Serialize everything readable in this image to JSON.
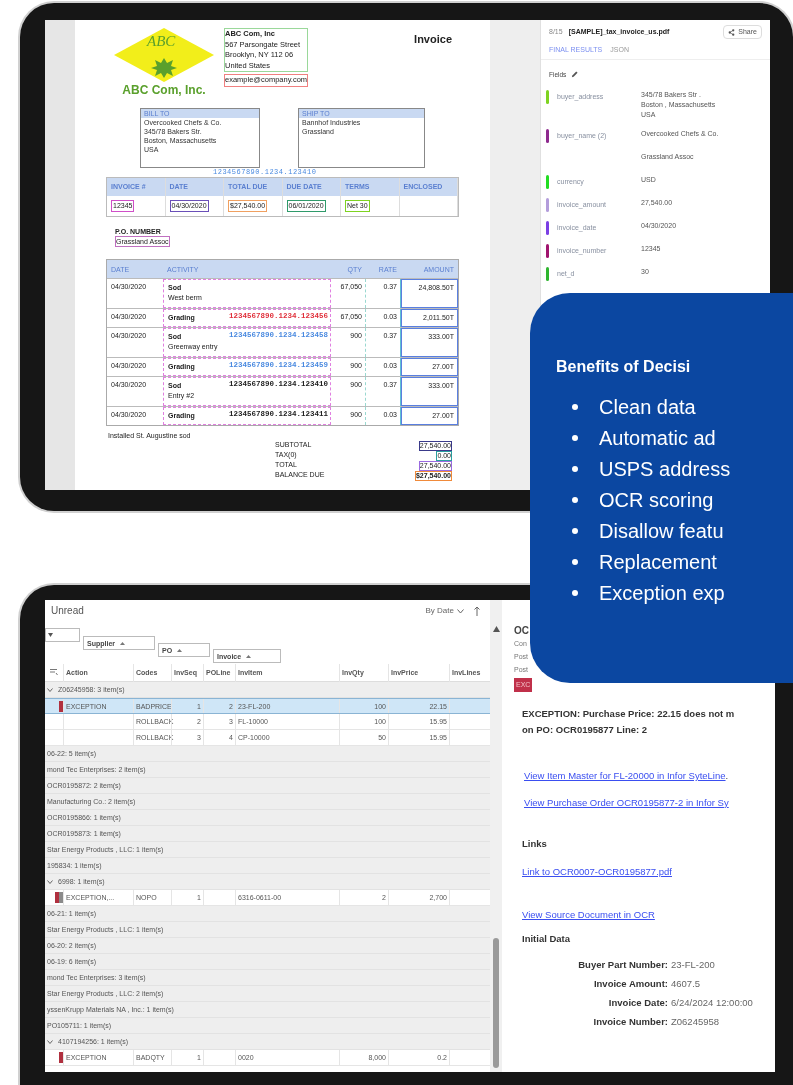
{
  "invoice_document": {
    "logo_text": "ABC",
    "company_name": "ABC Com, Inc.",
    "address": [
      "ABC Com, Inc",
      "567 Parsongate Street",
      "Brooklyn, NY 112 06",
      "United States"
    ],
    "email": "example@company.com",
    "title": "Invoice",
    "bill_to": {
      "label": "BILL TO",
      "lines": [
        "Overcooked Chefs & Co.",
        "345/78 Bakers Str.",
        "Boston, Massachusetts",
        "USA"
      ]
    },
    "ship_to": {
      "label": "SHIP TO",
      "lines": [
        "Bannhof Industries",
        "Grassland"
      ]
    },
    "reference_number": "1234567890.1234.123410",
    "summary": {
      "columns": [
        "INVOICE #",
        "DATE",
        "TOTAL DUE",
        "DUE DATE",
        "TERMS",
        "ENCLOSED"
      ],
      "values": [
        {
          "text": "12345",
          "color": "#d04fc8"
        },
        {
          "text": "04/30/2020",
          "color": "#6a4fb8"
        },
        {
          "text": "$27,540.00",
          "color": "#f0a060"
        },
        {
          "text": "06/01/2020",
          "color": "#2f9a6a"
        },
        {
          "text": "Net 30",
          "color": "#7ed321"
        }
      ]
    },
    "po_label": "P.O. NUMBER",
    "po_value": "Grassland Assoc",
    "items": {
      "columns": [
        "DATE",
        "ACTIVITY",
        "QTY",
        "RATE",
        "AMOUNT"
      ],
      "rows": [
        {
          "date": "04/30/2020",
          "activity": "Sod",
          "description": "West berm",
          "qty": "67,050",
          "rate": "0.37",
          "amount": "24,808.50T"
        },
        {
          "date": "04/30/2020",
          "activity": "Grading",
          "qty": "67,050",
          "rate": "0.03",
          "amount": "2,011.50T",
          "reference": {
            "text": "1234567890.1234.123456",
            "color": "#e0303a"
          }
        },
        {
          "date": "04/30/2020",
          "activity": "Sod",
          "description": "Greenway entry",
          "qty": "900",
          "rate": "0.37",
          "amount": "333.00T",
          "reference": {
            "text": "1234567890.1234.123458",
            "color": "#4a8ae0"
          }
        },
        {
          "date": "04/30/2020",
          "activity": "Grading",
          "qty": "900",
          "rate": "0.03",
          "amount": "27.00T",
          "reference": {
            "text": "1234567890.1234.123459",
            "color": "#4a8ae0"
          }
        },
        {
          "date": "04/30/2020",
          "activity": "Sod",
          "description": "Entry #2",
          "qty": "900",
          "rate": "0.37",
          "amount": "333.00T",
          "reference": {
            "text": "1234567890.1234.123410",
            "color": "#222222"
          }
        },
        {
          "date": "04/30/2020",
          "activity": "Grading",
          "qty": "900",
          "rate": "0.03",
          "amount": "27.00T",
          "reference": {
            "text": "1234567890.1234.123411",
            "color": "#222222"
          }
        }
      ]
    },
    "note": "Installed St. Augustine sod",
    "totals": [
      {
        "label": "SUBTOTAL",
        "value": "27,540.00",
        "color": "#3a3a8a"
      },
      {
        "label": "TAX(0)",
        "value": "0.00",
        "color": "#2aa0a0"
      },
      {
        "label": "TOTAL",
        "value": "27,540.00",
        "color": "#9a6ae0"
      },
      {
        "label": "BALANCE DUE",
        "value": "$27,540.00",
        "color": "#f08a3a"
      }
    ]
  },
  "results_panel": {
    "page": "8/15",
    "file_name": "[SAMPLE]_tax_invoice_us.pdf",
    "share_label": "Share",
    "tabs": [
      {
        "label": "FINAL RESULTS",
        "selected": true
      },
      {
        "label": "JSON",
        "selected": false
      }
    ],
    "fields_title": "Fields",
    "fields": [
      {
        "name": "buyer_address",
        "values": [
          "345/78 Bakers Str .\nBoston , Massachusetts\nUSA"
        ],
        "color": "#7ed321"
      },
      {
        "name": "buyer_name (2)",
        "values": [
          "Overcooked Chefs & Co.",
          "Grassland Assoc"
        ],
        "color": "#8e2a8e"
      },
      {
        "name": "currency",
        "values": [
          "USD"
        ],
        "color": "#22dd22"
      },
      {
        "name": "invoice_amount",
        "values": [
          "27,540.00"
        ],
        "color": "#b39ddb"
      },
      {
        "name": "invoice_date",
        "values": [
          "04/30/2020"
        ],
        "color": "#7b3fe4"
      },
      {
        "name": "invoice_number",
        "values": [
          "12345"
        ],
        "color": "#a0146e"
      },
      {
        "name": "net_d",
        "values": [
          "30"
        ],
        "color": "#2fb52f"
      }
    ]
  },
  "benefits_callout": {
    "title": "Benefits of Decisi",
    "items": [
      "Clean data",
      "Automatic ad",
      "USPS address",
      "OCR scoring",
      "Disallow featu",
      "Replacement",
      "Exception exp"
    ]
  },
  "inbox_list": {
    "title": "Unread",
    "sort_label": "By Date",
    "group_chips": [
      "Supplier",
      "PO",
      "Invoice"
    ],
    "columns": [
      "Action",
      "Codes",
      "InvSeq",
      "POLine",
      "InvItem",
      "InvQty",
      "InvPrice",
      "InvLines"
    ],
    "rows": [
      {
        "kind": "group",
        "text": "Z06245958: 3 item(s)",
        "expanded": true
      },
      {
        "kind": "item",
        "markers": [
          {
            "color": "#b0303f"
          }
        ],
        "action": "EXCEPTION",
        "code": "BADPRICE",
        "inv_seq": "1",
        "po_line": "2",
        "inv_item": "23-FL-200",
        "inv_qty": "100",
        "inv_price": "22.15",
        "selected": true
      },
      {
        "kind": "item",
        "code": "ROLLBACK",
        "inv_seq": "2",
        "po_line": "3",
        "inv_item": "FL-10000",
        "inv_qty": "100",
        "inv_price": "15.95",
        "selected": false
      },
      {
        "kind": "item",
        "code": "ROLLBACK",
        "inv_seq": "3",
        "po_line": "4",
        "inv_item": "CP-10000",
        "inv_qty": "50",
        "inv_price": "15.95",
        "selected": false
      },
      {
        "kind": "group",
        "text": "06-22: 5 item(s)",
        "expanded": false
      },
      {
        "kind": "group",
        "text": "mond Tec Enterprises: 2 item(s)",
        "expanded": false
      },
      {
        "kind": "group",
        "text": "OCR0195872: 2 item(s)",
        "expanded": false
      },
      {
        "kind": "group",
        "text": "Manufacturing Co.: 2 item(s)",
        "expanded": false
      },
      {
        "kind": "group",
        "text": "OCR0195866: 1 item(s)",
        "expanded": false
      },
      {
        "kind": "group",
        "text": "OCR0195873: 1 item(s)",
        "expanded": false
      },
      {
        "kind": "group",
        "text": "Star Energy Products , LLC: 1 item(s)",
        "expanded": false
      },
      {
        "kind": "group",
        "text": "195834: 1 item(s)",
        "expanded": false
      },
      {
        "kind": "group",
        "text": "6998: 1 item(s)",
        "expanded": true
      },
      {
        "kind": "item",
        "markers": [
          {
            "color": "#b0303f"
          },
          {
            "color": "#8a8a8a"
          }
        ],
        "action": "EXCEPTION,...",
        "code": "NOPO",
        "inv_seq": "1",
        "inv_item": "6316-0611-00",
        "inv_qty": "2",
        "inv_price": "2,700",
        "selected": false
      },
      {
        "kind": "group",
        "text": "06-21: 1 item(s)",
        "expanded": false
      },
      {
        "kind": "group",
        "text": "Star Energy Products , LLC: 1 item(s)",
        "expanded": false
      },
      {
        "kind": "group",
        "text": "06-20: 2 item(s)",
        "expanded": false
      },
      {
        "kind": "group",
        "text": "06-19: 6 item(s)",
        "expanded": false
      },
      {
        "kind": "group",
        "text": "mond Tec Enterprises: 3 item(s)",
        "expanded": false
      },
      {
        "kind": "group",
        "text": "Star Energy Products , LLC: 2 item(s)",
        "expanded": false
      },
      {
        "kind": "group",
        "text": "yssenKrupp Materials NA , Inc.: 1 item(s)",
        "expanded": false
      },
      {
        "kind": "group",
        "text": "PO105711: 1 item(s)",
        "expanded": false
      },
      {
        "kind": "group",
        "text": "4107194256: 1 item(s)",
        "expanded": true
      },
      {
        "kind": "item",
        "markers": [
          {
            "color": "#b0303f"
          }
        ],
        "action": "EXCEPTION",
        "code": "BADQTY",
        "inv_seq": "1",
        "inv_item": "0020",
        "inv_qty": "8,000",
        "inv_price": "0.2",
        "selected": false
      }
    ]
  },
  "detail_panel": {
    "title": "OC",
    "meta": [
      "Con",
      "Post",
      "Post"
    ],
    "badge": "EXC",
    "exception_text": "EXCEPTION: Purchase Price: 22.15 does not m\non PO: OCR0195877 Line: 2",
    "action_links": [
      {
        "text": "View Item Master for FL-20000 in Infor SyteLine",
        "trailing": "."
      },
      {
        "text": "View Purchase Order OCR0195877-2 in Infor Sy"
      }
    ],
    "links_title": "Links",
    "links": [
      "Link to OCR0007-OCR0195877.pdf"
    ],
    "source_link": "View Source Document in OCR",
    "initial_data_title": "Initial Data",
    "initial_data": [
      {
        "label": "Buyer Part Number:",
        "value": "23-FL-200"
      },
      {
        "label": "Invoice Amount:",
        "value": "4607.5"
      },
      {
        "label": "Invoice Date:",
        "value": "6/24/2024 12:00:00"
      },
      {
        "label": "Invoice Number:",
        "value": "Z06245958"
      }
    ]
  }
}
